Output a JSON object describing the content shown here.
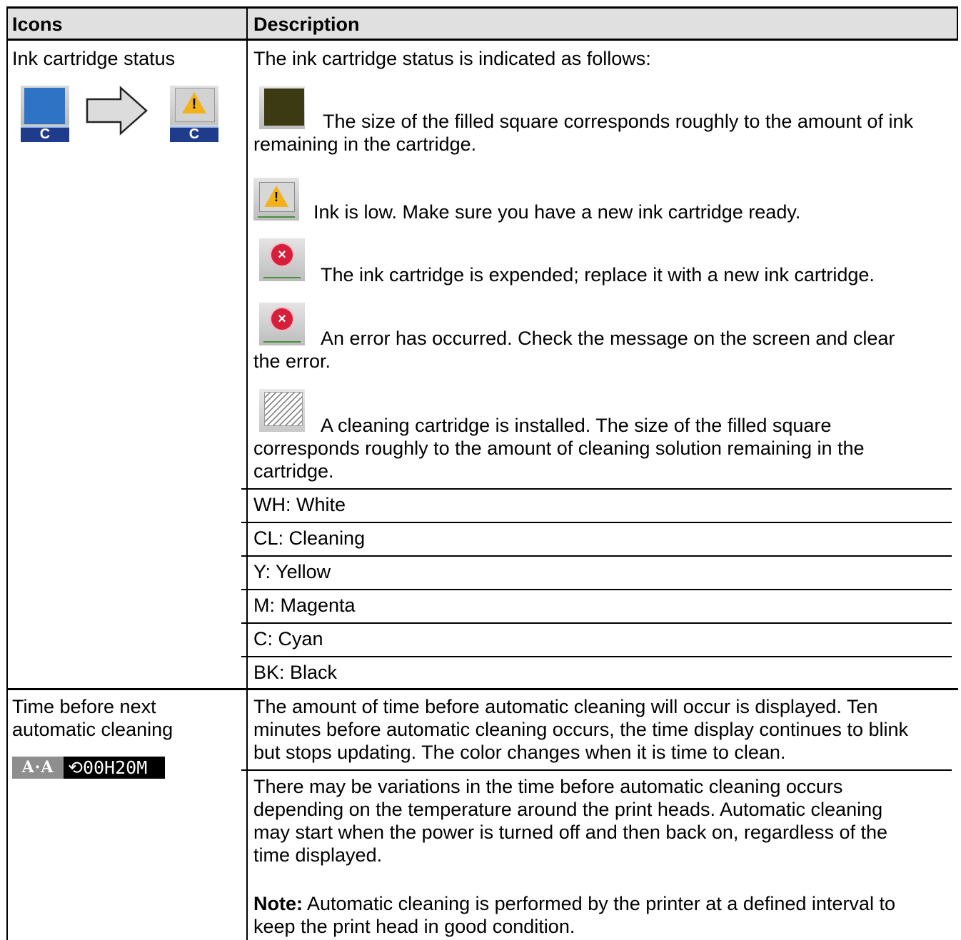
{
  "header": {
    "col1": "Icons",
    "col2": "Description"
  },
  "row1": {
    "left_label": "Ink cartridge status",
    "cartridge_letter": "C",
    "intro": "The ink cartridge status is indicated as follows:",
    "items": [
      {
        "icon": "ink-level-square-icon",
        "text_first": "The size of the filled square corresponds roughly to the amount of ink",
        "text_rest": "remaining in the cartridge."
      },
      {
        "icon": "warning-icon",
        "text_first": "Ink is low. Make sure you have a new ink cartridge ready.",
        "text_rest": ""
      },
      {
        "icon": "error-icon",
        "text_first": "The ink cartridge is expended; replace it with a new ink cartridge.",
        "text_rest": ""
      },
      {
        "icon": "error-icon",
        "text_first": "An error has occurred. Check the message on the screen and clear",
        "text_rest": "the error."
      },
      {
        "icon": "cleaning-cartridge-icon",
        "text_first": "A cleaning cartridge is installed. The size of the filled square",
        "text_rest1": "corresponds roughly to the amount of cleaning solution remaining in the",
        "text_rest2": "cartridge."
      }
    ],
    "colors": [
      "WH: White",
      "CL: Cleaning",
      "Y: Yellow",
      "M: Magenta",
      "C: Cyan",
      "BK: Black"
    ]
  },
  "row2": {
    "left_line1": "Time before next",
    "left_line2": "automatic cleaning",
    "timer_aa": "A·A",
    "timer_value": "⟲00H20M",
    "para1": [
      "The amount of time before automatic cleaning will occur is displayed. Ten",
      "minutes before automatic cleaning occurs, the time display continues to blink",
      "but stops updating. The color changes when it is time to clean."
    ],
    "para2": [
      "There may be variations in the time before automatic cleaning occurs",
      "depending on the temperature around the print heads. Automatic cleaning",
      "may start when the power is turned off and then back on, regardless of the",
      "time displayed."
    ],
    "note_label": "Note:",
    "note_first": "Automatic cleaning is performed by the printer at a defined interval to",
    "note_rest": "keep the print head in good condition."
  }
}
